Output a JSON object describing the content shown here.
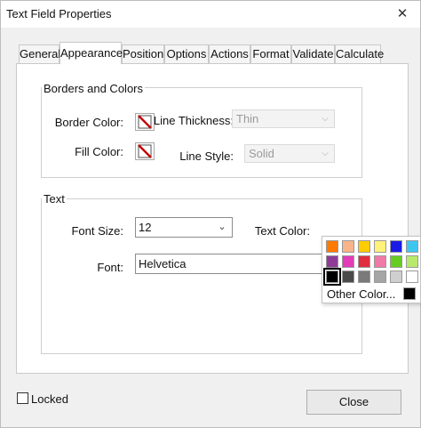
{
  "window": {
    "title": "Text Field Properties",
    "close_glyph": "✕"
  },
  "tabs": [
    {
      "label": "General"
    },
    {
      "label": "Appearance"
    },
    {
      "label": "Position"
    },
    {
      "label": "Options"
    },
    {
      "label": "Actions"
    },
    {
      "label": "Format"
    },
    {
      "label": "Validate"
    },
    {
      "label": "Calculate"
    }
  ],
  "active_tab": "Appearance",
  "borders_colors": {
    "group_label": "Borders and Colors",
    "border_color_label": "Border Color:",
    "fill_color_label": "Fill Color:",
    "line_thickness_label": "Line Thickness:",
    "line_thickness_value": "Thin",
    "line_style_label": "Line Style:",
    "line_style_value": "Solid"
  },
  "text_group": {
    "group_label": "Text",
    "font_size_label": "Font Size:",
    "font_size_value": "12",
    "text_color_label": "Text Color:",
    "text_color": "#000000",
    "font_label": "Font:",
    "font_value": "Helvetica"
  },
  "color_palette": {
    "rows": [
      [
        "#ff7a00",
        "#f8b48a",
        "#ffcc00",
        "#fff17a",
        "#1a1ae6",
        "#3fc6f0"
      ],
      [
        "#8e3b98",
        "#e23cb8",
        "#e02e3f",
        "#f07aa6",
        "#66cc22",
        "#b7ea6c"
      ],
      [
        "#000000",
        "#4a4a4a",
        "#7a7a7a",
        "#a5a5a5",
        "#cfcfcf",
        "#ffffff"
      ]
    ],
    "selected": "#000000",
    "other_label": "Other Color...",
    "other_color": "#000000"
  },
  "locked_label": "Locked",
  "close_button_label": "Close"
}
